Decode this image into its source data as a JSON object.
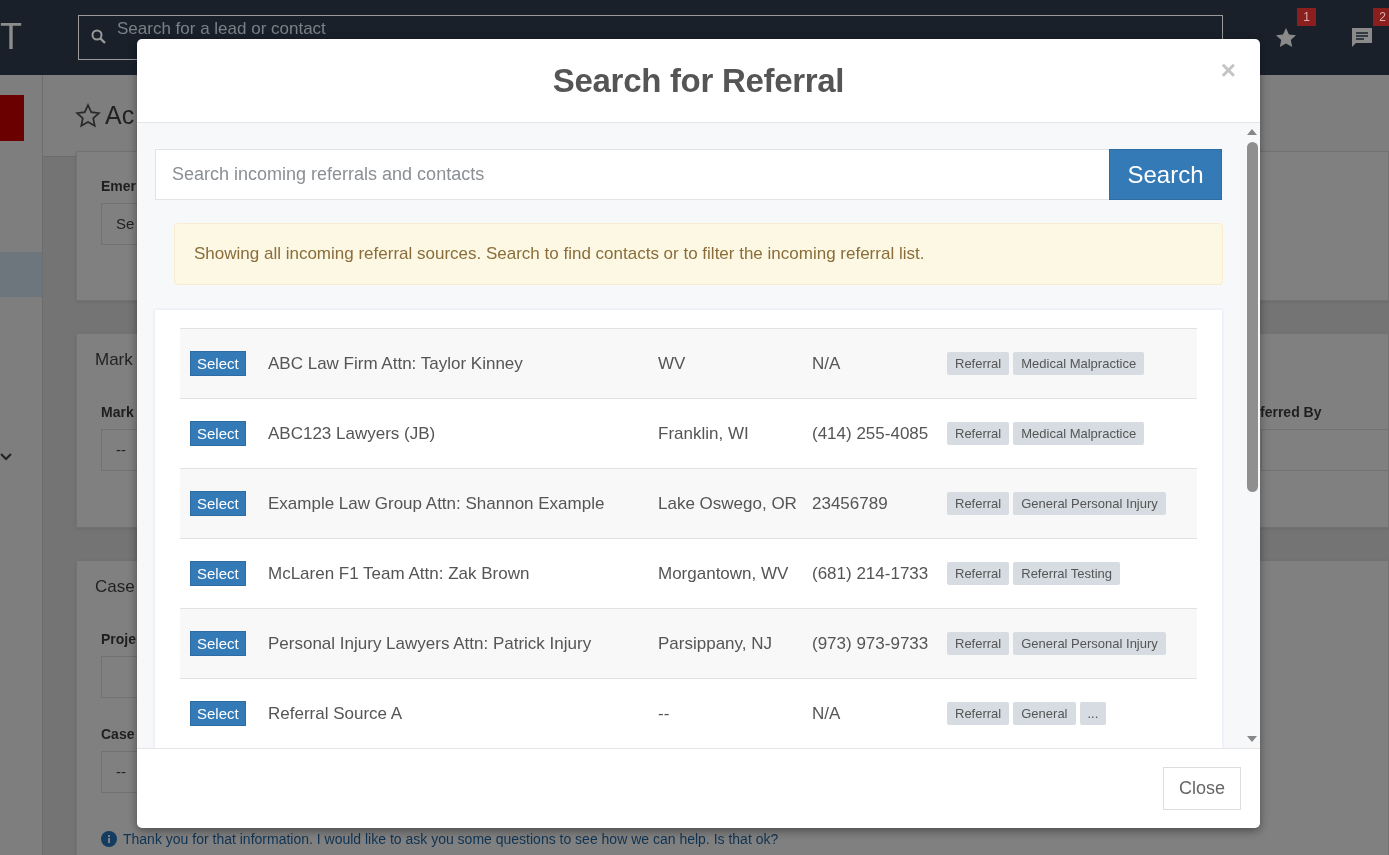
{
  "topbar": {
    "logo": "T",
    "search_placeholder": "Search for a lead or contact",
    "notifications": [
      {
        "kind": "star",
        "count": "1"
      },
      {
        "kind": "chat",
        "count": "2"
      }
    ]
  },
  "page": {
    "header_title": "Ac",
    "cards": [
      {
        "fields": [
          {
            "label": "Emer",
            "value": "Se"
          }
        ]
      },
      {
        "title": "Mark",
        "fields": [
          {
            "label": "Mark",
            "value": "--"
          }
        ],
        "side_label": "ferred By"
      },
      {
        "title": "Case",
        "fields": [
          {
            "label": "Proje"
          },
          {
            "label": "Case",
            "value": "--"
          }
        ],
        "note": "Thank you for that information. I would like to ask you some questions to see how we can help. Is that ok?"
      }
    ]
  },
  "modal": {
    "title": "Search for Referral",
    "close_icon": "×",
    "search": {
      "placeholder": "Search incoming referrals and contacts",
      "button": "Search"
    },
    "alert": "Showing all incoming referral sources. Search to find contacts or to filter the incoming referral list.",
    "rows": [
      {
        "button": "Select",
        "name": "ABC Law Firm Attn: Taylor Kinney",
        "location": "WV",
        "phone": "N/A",
        "tags": [
          "Referral",
          "Medical Malpractice"
        ]
      },
      {
        "button": "Select",
        "name": "ABC123 Lawyers (JB)",
        "location": "Franklin, WI",
        "phone": "(414) 255-4085",
        "tags": [
          "Referral",
          "Medical Malpractice"
        ]
      },
      {
        "button": "Select",
        "name": "Example Law Group Attn: Shannon Example",
        "location": "Lake Oswego, OR",
        "phone": "23456789",
        "tags": [
          "Referral",
          "General Personal Injury"
        ]
      },
      {
        "button": "Select",
        "name": "McLaren F1 Team Attn: Zak Brown",
        "location": "Morgantown, WV",
        "phone": "(681) 214-1733",
        "tags": [
          "Referral",
          "Referral Testing"
        ]
      },
      {
        "button": "Select",
        "name": "Personal Injury Lawyers Attn: Patrick Injury",
        "location": "Parsippany, NJ",
        "phone": "(973) 973-9733",
        "tags": [
          "Referral",
          "General Personal Injury"
        ]
      },
      {
        "button": "Select",
        "name": "Referral Source A",
        "location": "--",
        "phone": "N/A",
        "tags": [
          "Referral",
          "General",
          "..."
        ]
      }
    ],
    "close_button": "Close"
  }
}
